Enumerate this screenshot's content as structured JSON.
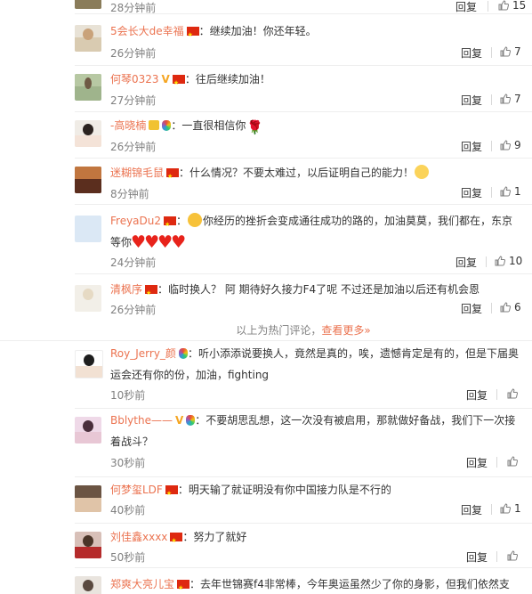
{
  "labels": {
    "reply": "回复"
  },
  "hot_more": {
    "prefix": "以上为热门评论，",
    "link": "查看更多»"
  },
  "comments_top": [
    {
      "user": "",
      "text": "",
      "time": "28分钟前",
      "likes": "15",
      "badges": []
    },
    {
      "user": "5会长大de幸福",
      "text": "：继续加油！你还年轻。",
      "time": "26分钟前",
      "likes": "7",
      "badges": [
        "flag"
      ]
    },
    {
      "user": "何琴0323",
      "text": "：往后继续加油！",
      "time": "27分钟前",
      "likes": "7",
      "badges": [
        "v",
        "flag"
      ]
    },
    {
      "user": "-高晓楠",
      "text": "：一直很相信你",
      "time": "26分钟前",
      "likes": "9",
      "badges": [
        "crown",
        "ring"
      ]
    },
    {
      "user": "迷糊锦毛鼠",
      "text": "：什么情况？不要太难过，以后证明自己的能力！",
      "time": "8分钟前",
      "likes": "1",
      "badges": [
        "flag"
      ]
    },
    {
      "user": "FreyaDu2",
      "text": "你经历的挫折会变成通往成功的路的，加油莫莫，我们都在，东京",
      "text2": "等你",
      "time": "24分钟前",
      "likes": "10",
      "badges": [
        "flag"
      ]
    },
    {
      "user": "清枫序",
      "text": "：临时换人？ 阿 期待好久接力F4了呢 不过还是加油以后还有机会恩",
      "time": "26分钟前",
      "likes": "6",
      "badges": [
        "flag"
      ]
    }
  ],
  "comments_new": [
    {
      "user": "Roy_Jerry_颜",
      "text": "：听小添添说要换人，竟然是真的，唉，遗憾肯定是有的，但是下届奥",
      "text2": "运会还有你的份，加油，fighting",
      "time": "10秒前",
      "likes": "",
      "badges": [
        "ring"
      ]
    },
    {
      "user": "Bblythe——",
      "text": "：不要胡思乱想，这一次没有被启用，那就做好备战，我们下一次接",
      "text2": "着战斗？",
      "time": "30秒前",
      "likes": "",
      "badges": [
        "v",
        "ring"
      ]
    },
    {
      "user": "何梦玺LDF",
      "text": "：明天输了就证明没有你中国接力队是不行的",
      "time": "40秒前",
      "likes": "1",
      "badges": [
        "flag"
      ]
    },
    {
      "user": "刘佳鑫xxxx",
      "text": "：努力了就好",
      "time": "50秒前",
      "likes": "",
      "badges": [
        "flag"
      ]
    },
    {
      "user": "郑爽大亮儿宝",
      "text": "：去年世锦赛f4非常棒，今年奥运虽然少了你的身影，但我们依然支",
      "time": "",
      "likes": "",
      "badges": [
        "flag"
      ]
    }
  ],
  "colors": {
    "username": "#eb7350",
    "time": "#808080",
    "text": "#333333"
  }
}
